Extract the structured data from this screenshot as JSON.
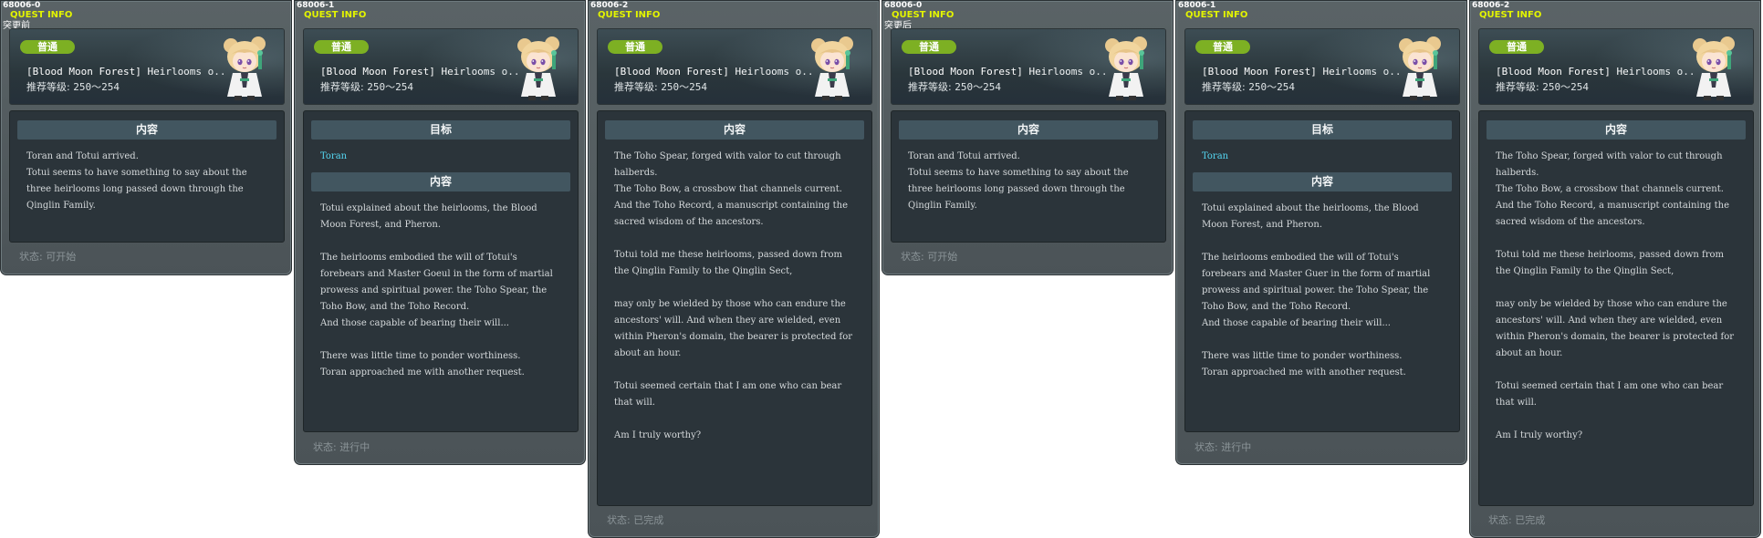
{
  "shared": {
    "quest_info_title": "QUEST INFO",
    "badge_label": "普通",
    "quest_name": "[Blood Moon Forest] Heirlooms o..",
    "level_label": "推荐等级:",
    "level_range": "250～254",
    "content_label": "内容",
    "target_label": "目标",
    "status_prefix": "状态:"
  },
  "windows": [
    {
      "quest_id": "68006-0",
      "state_tag": "突更前",
      "status": "可开始",
      "content": "Toran and Totui arrived.\nTotui seems to have something to say about the three heirlooms long passed down through the Qinglin Family."
    },
    {
      "quest_id": "68006-1",
      "target": "Toran",
      "status": "进行中",
      "content": "Totui explained about the heirlooms, the Blood Moon Forest, and Pheron.\n\nThe heirlooms embodied the will of Totui's forebears and Master Goeul in the form of martial prowess and spiritual power. the Toho Spear, the Toho Bow, and the Toho Record.\nAnd those capable of bearing their will...\n\nThere was little time to ponder worthiness.\nToran approached me with another request."
    },
    {
      "quest_id": "68006-2",
      "status": "已完成",
      "content": "The Toho Spear, forged with valor to cut through halberds.\nThe Toho Bow, a crossbow that channels current.\nAnd the Toho Record, a manuscript containing the sacred wisdom of the ancestors.\n\nTotui told me these heirlooms, passed down from the Qinglin Family to the Qinglin Sect,\n\nmay only be wielded by those who can endure the ancestors' will. And when they are wielded, even within Pheron's domain, the bearer is protected for about an hour.\n\nTotui seemed certain that I am one who can bear that will.\n\nAm I truly worthy?"
    },
    {
      "quest_id": "68006-0",
      "state_tag": "突更后",
      "status": "可开始",
      "content": "Toran and Totui arrived.\nTotui seems to have something to say about the three heirlooms long passed down through the Qinglin Family."
    },
    {
      "quest_id": "68006-1",
      "target": "Toran",
      "status": "进行中",
      "content": "Totui explained about the heirlooms, the Blood Moon Forest, and Pheron.\n\nThe heirlooms embodied the will of Totui's forebears and Master Guer in the form of martial prowess and spiritual power. the Toho Spear, the Toho Bow, and the Toho Record.\nAnd those capable of bearing their will...\n\nThere was little time to ponder worthiness.\nToran approached me with another request."
    },
    {
      "quest_id": "68006-2",
      "status": "已完成",
      "content": "The Toho Spear, forged with valor to cut through halberds.\nThe Toho Bow, a crossbow that channels current.\nAnd the Toho Record, a manuscript containing the sacred wisdom of the ancestors.\n\nTotui told me these heirlooms, passed down from the Qinglin Family to the Qinglin Sect,\n\nmay only be wielded by those who can endure the ancestors' will. And when they are wielded, even within Pheron's domain, the bearer is protected for about an hour.\n\nTotui seemed certain that I am one who can bear that will.\n\nAm I truly worthy?"
    }
  ]
}
